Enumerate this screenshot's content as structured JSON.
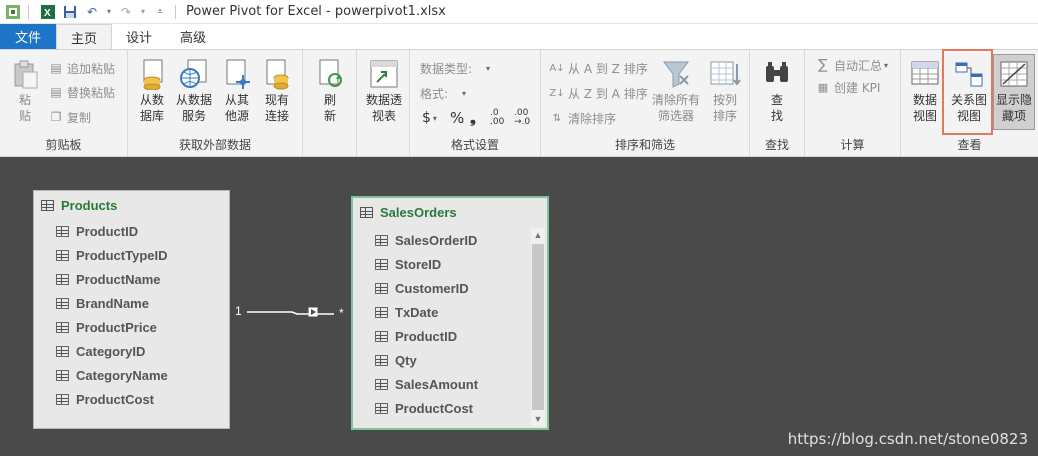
{
  "window": {
    "title": "Power Pivot for Excel - powerpivot1.xlsx"
  },
  "tabs": [
    {
      "label": "文件"
    },
    {
      "label": "主页"
    },
    {
      "label": "设计"
    },
    {
      "label": "高级"
    }
  ],
  "ribbon": {
    "clipboard": {
      "label": "剪贴板",
      "paste": "粘\n贴",
      "paste_append": "追加粘贴",
      "paste_replace": "替换粘贴",
      "copy": "复制"
    },
    "get_external": {
      "label": "获取外部数据",
      "from_db": "从数\n据库",
      "from_service": "从数据\n服务",
      "from_other": "从其\n他源",
      "existing": "现有\n连接"
    },
    "refresh": {
      "label": "刷\n新"
    },
    "pivot": {
      "label": "数据透\n视表"
    },
    "format": {
      "label": "格式设置",
      "data_type": "数据类型:",
      "format": "格式:",
      "currency": "$",
      "percent": "%",
      "comma": "❟",
      "inc_decimal": ".0\n.00",
      "dec_decimal": ".00\n→.0"
    },
    "sort_filter": {
      "label": "排序和筛选",
      "sort_az": "从 A 到 Z 排序",
      "sort_za": "从 Z 到 A 排序",
      "clear_sort": "清除排序",
      "clear_filters": "清除所有\n筛选器",
      "sort_by_column": "按列\n排序"
    },
    "find": {
      "label": "查找",
      "find": "查\n找"
    },
    "calculations": {
      "label": "计算",
      "autosum": "自动汇总",
      "create_kpi": "创建 KPI"
    },
    "view": {
      "label": "查看",
      "data_view": "数据\n视图",
      "diagram_view": "关系图\n视图",
      "show_hidden": "显示隐\n藏项"
    }
  },
  "tables": {
    "products": {
      "name": "Products",
      "fields": [
        "ProductID",
        "ProductTypeID",
        "ProductName",
        "BrandName",
        "ProductPrice",
        "CategoryID",
        "CategoryName",
        "ProductCost"
      ]
    },
    "salesorders": {
      "name": "SalesOrders",
      "fields": [
        "SalesOrderID",
        "StoreID",
        "CustomerID",
        "TxDate",
        "ProductID",
        "Qty",
        "SalesAmount",
        "ProductCost"
      ]
    }
  },
  "relationship": {
    "from_cardinality": "1",
    "to_cardinality": "*"
  },
  "watermark": "https://blog.csdn.net/stone0823"
}
